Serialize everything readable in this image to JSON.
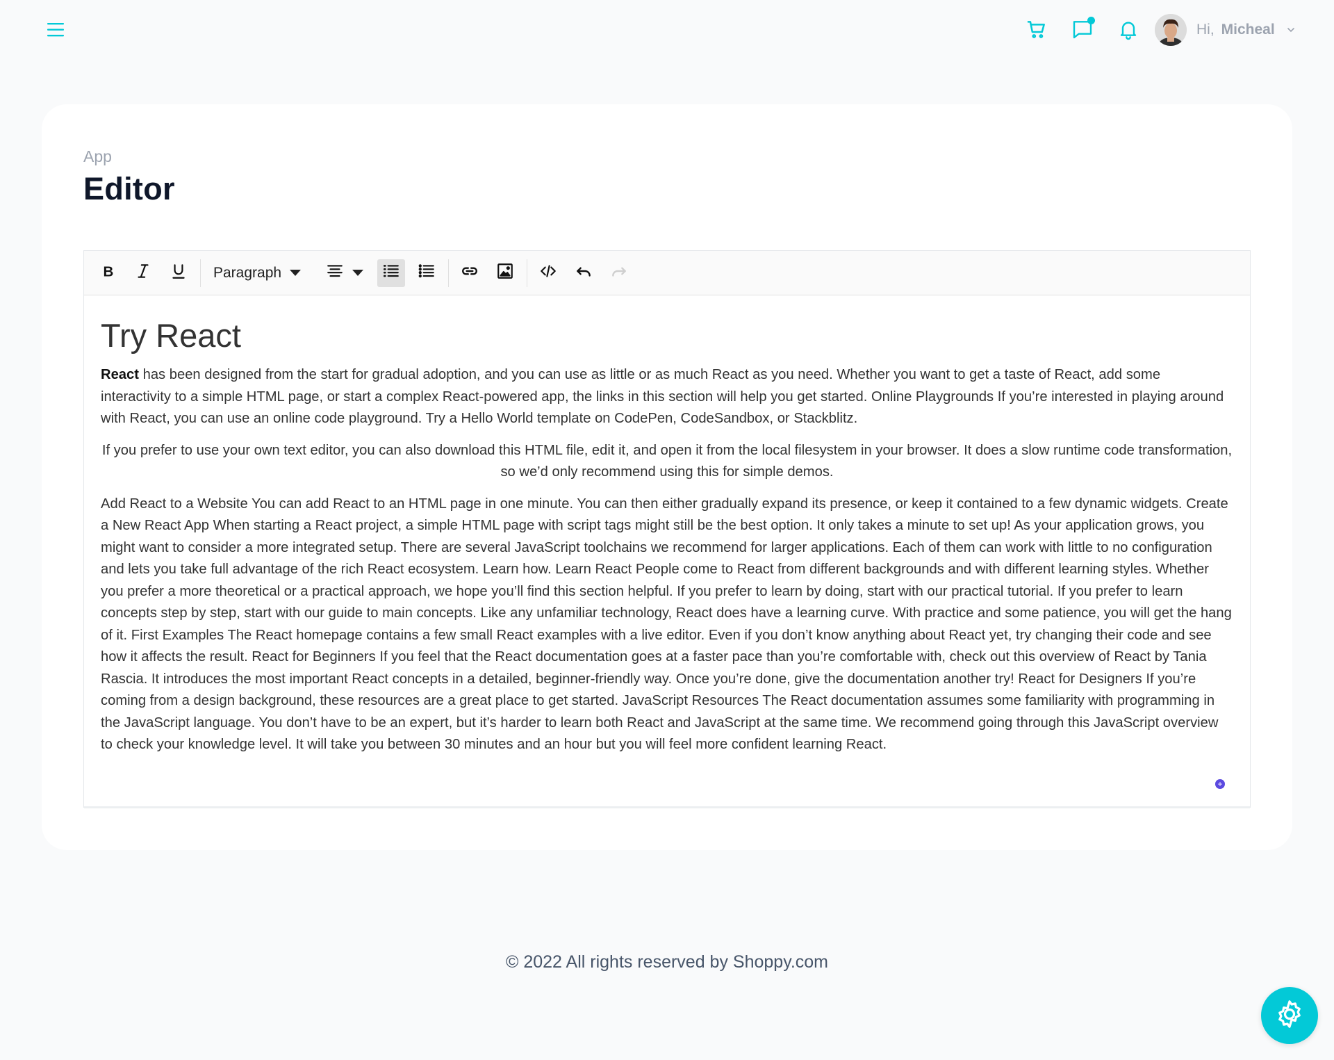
{
  "colors": {
    "accent": "#03c9d7",
    "page_bg": "#f9fafb",
    "card_bg": "#ffffff",
    "title": "#0f172a",
    "muted": "#9ca3af"
  },
  "navbar": {
    "menu_icon": "hamburger-icon",
    "cart_icon": "cart-icon",
    "chat_icon": "chat-icon",
    "notification_icon": "bell-icon",
    "greeting": "Hi,",
    "user_name": "Micheal",
    "dropdown_icon": "chevron-down-icon"
  },
  "page": {
    "breadcrumb": "App",
    "title": "Editor"
  },
  "toolbar": {
    "bold": "B",
    "italic": "I",
    "underline": "U",
    "format_select": "Paragraph",
    "icons": [
      "bold-icon",
      "italic-icon",
      "underline-icon",
      "align-icon",
      "ordered-list-icon",
      "unordered-list-icon",
      "link-icon",
      "image-icon",
      "source-code-icon",
      "undo-icon",
      "redo-icon"
    ]
  },
  "document": {
    "heading": "Try React",
    "p1_strong": "React",
    "p1_rest": " has been designed from the start for gradual adoption, and you can use as little or as much React as you need. Whether you want to get a taste of React, add some interactivity to a simple HTML page, or start a complex React-powered app, the links in this section will help you get started. Online Playgrounds If you’re interested in playing around with React, you can use an online code playground. Try a Hello World template on CodePen, CodeSandbox, or Stackblitz.",
    "p2": "If you prefer to use your own text editor, you can also download this HTML file, edit it, and open it from the local filesystem in your browser. It does a slow runtime code transformation, so we’d only recommend using this for simple demos.",
    "p3": "Add React to a Website You can add React to an HTML page in one minute. You can then either gradually expand its presence, or keep it contained to a few dynamic widgets. Create a New React App When starting a React project, a simple HTML page with script tags might still be the best option. It only takes a minute to set up! As your application grows, you might want to consider a more integrated setup. There are several JavaScript toolchains we recommend for larger applications. Each of them can work with little to no configuration and lets you take full advantage of the rich React ecosystem. Learn how. Learn React People come to React from different backgrounds and with different learning styles. Whether you prefer a more theoretical or a practical approach, we hope you’ll find this section helpful. If you prefer to learn by doing, start with our practical tutorial. If you prefer to learn concepts step by step, start with our guide to main concepts. Like any unfamiliar technology, React does have a learning curve. With practice and some patience, you will get the hang of it. First Examples The React homepage contains a few small React examples with a live editor. Even if you don’t know anything about React yet, try changing their code and see how it affects the result. React for Beginners If you feel that the React documentation goes at a faster pace than you’re comfortable with, check out this overview of React by Tania Rascia. It introduces the most important React concepts in a detailed, beginner-friendly way. Once you’re done, give the documentation another try! React for Designers If you’re coming from a design background, these resources are a great place to get started. JavaScript Resources The React documentation assumes some familiarity with programming in the JavaScript language. You don’t have to be an expert, but it’s harder to learn both React and JavaScript at the same time. We recommend going through this JavaScript overview to check your knowledge level. It will take you between 30 minutes and an hour but you will feel more confident learning React."
  },
  "footer": {
    "text": "© 2022 All rights reserved by Shoppy.com"
  },
  "settings_fab": {
    "icon": "gear-icon"
  }
}
